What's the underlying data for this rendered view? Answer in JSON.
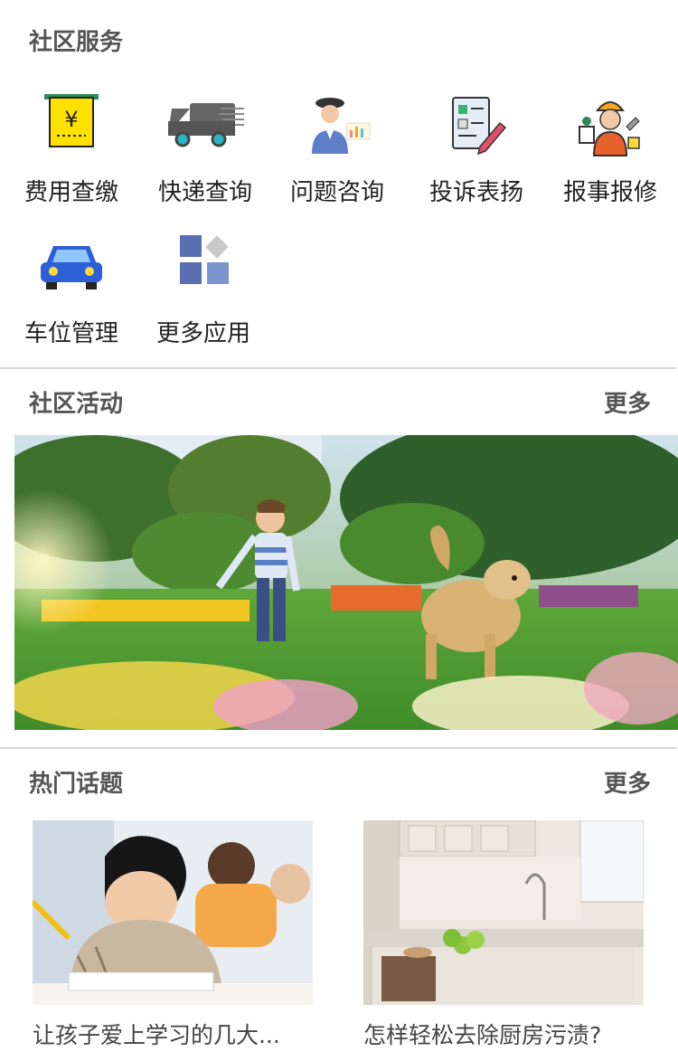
{
  "community_services": {
    "title": "社区服务",
    "items": [
      {
        "label": "费用查缴",
        "icon": "payment-icon"
      },
      {
        "label": "快递查询",
        "icon": "delivery-truck-icon"
      },
      {
        "label": "问题咨询",
        "icon": "consultant-icon"
      },
      {
        "label": "投诉表扬",
        "icon": "complaint-form-icon"
      },
      {
        "label": "报事报修",
        "icon": "repair-worker-icon"
      },
      {
        "label": "车位管理",
        "icon": "car-icon"
      },
      {
        "label": "更多应用",
        "icon": "more-apps-icon"
      }
    ]
  },
  "community_activities": {
    "title": "社区活动",
    "more_label": "更多",
    "banner": {
      "icon": "child-and-dog-in-park-photo"
    }
  },
  "hot_topics": {
    "title": "热门话题",
    "more_label": "更多",
    "items": [
      {
        "caption": "让孩子爱上学习的几大...",
        "icon": "child-studying-photo"
      },
      {
        "caption": "怎样轻松去除厨房污渍?",
        "icon": "kitchen-photo"
      }
    ]
  },
  "colors": {
    "section_title": "#555555",
    "divider": "#d6d6d6"
  }
}
